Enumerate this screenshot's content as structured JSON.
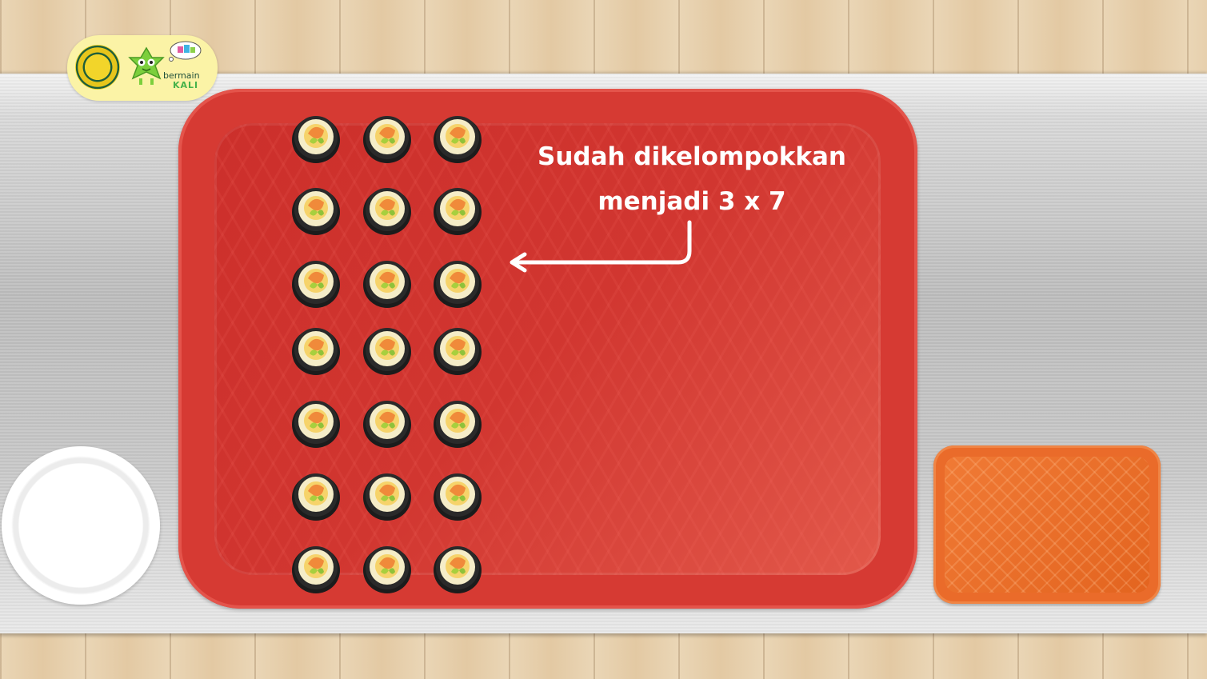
{
  "caption": {
    "line1": "Sudah dikelompokkan",
    "line2": "menjadi 3 x 7"
  },
  "logo": {
    "brand_top": "bermain",
    "brand_bottom": "KALI"
  },
  "grid": {
    "columns": 3,
    "rows": 7,
    "item": "sushi-roll"
  },
  "colors": {
    "tray_main": "#d63a33",
    "tray_small": "#ea6b2a",
    "plate": "#ffffff",
    "caption_text": "#ffffff"
  }
}
